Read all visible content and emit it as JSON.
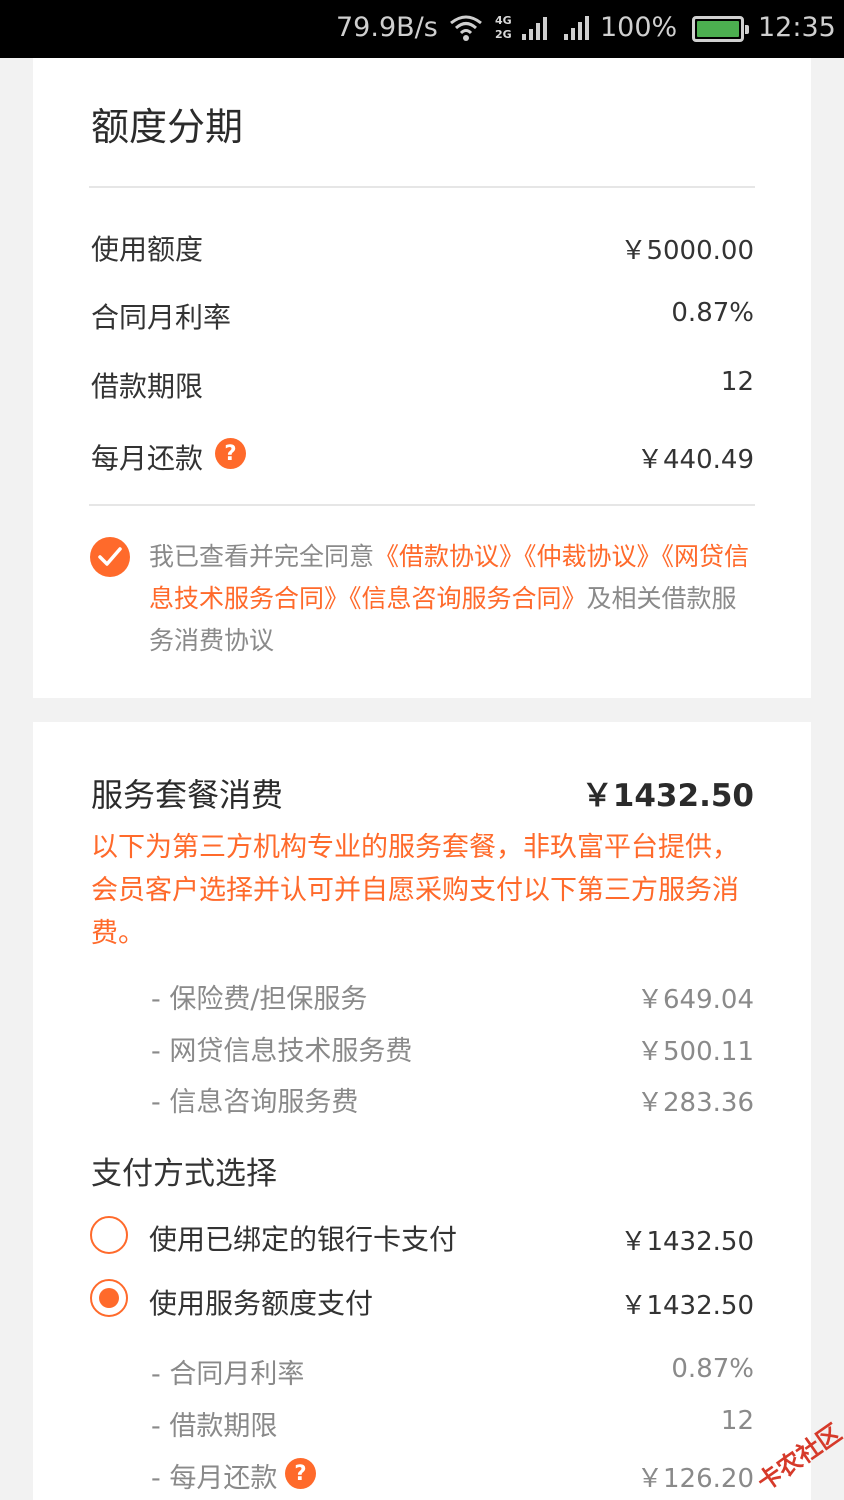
{
  "status_bar": {
    "net_speed": "79.9B/s",
    "network_top": "4G",
    "network_bottom": "2G",
    "battery": "100%",
    "time": "12:35",
    "battery_color": "#4caf50"
  },
  "limit_section": {
    "title": "额度分期",
    "rows": [
      {
        "label": "使用额度",
        "value": "￥5000.00"
      },
      {
        "label": "合同月利率",
        "value": "0.87%"
      },
      {
        "label": "借款期限",
        "value": "12"
      },
      {
        "label": "每月还款",
        "value": "￥440.49"
      }
    ],
    "help_icon": "?",
    "agreement": {
      "checked": true,
      "prefix": "我已查看并完全同意",
      "links": [
        "《借款协议》",
        "《仲裁协议》",
        "《网贷信息技术服务合同》",
        "《信息咨询服务合同》"
      ],
      "suffix": "及相关借款服务消费协议"
    }
  },
  "service_section": {
    "title": "服务套餐消费",
    "total": "￥1432.50",
    "notice": "以下为第三方机构专业的服务套餐，非玖富平台提供，会员客户选择并认可并自愿采购支付以下第三方服务消费。",
    "items": [
      {
        "label": "- 保险费/担保服务",
        "value": "￥649.04"
      },
      {
        "label": "- 网贷信息技术服务费",
        "value": "￥500.11"
      },
      {
        "label": "- 信息咨询服务费",
        "value": "￥283.36"
      }
    ],
    "payment": {
      "title": "支付方式选择",
      "options": [
        {
          "label": "使用已绑定的银行卡支付",
          "value": "￥1432.50",
          "selected": false
        },
        {
          "label": "使用服务额度支付",
          "value": "￥1432.50",
          "selected": true
        }
      ],
      "details": [
        {
          "label": "- 合同月利率",
          "value": "0.87%"
        },
        {
          "label": "- 借款期限",
          "value": "12"
        },
        {
          "label": "- 每月还款",
          "value": "￥126.20"
        }
      ]
    }
  },
  "watermark": {
    "text": "卡农社区"
  },
  "colors": {
    "accent": "#ff6a2b",
    "text": "#333333",
    "muted": "#8a8a8a",
    "background": "#f2f2f2"
  }
}
